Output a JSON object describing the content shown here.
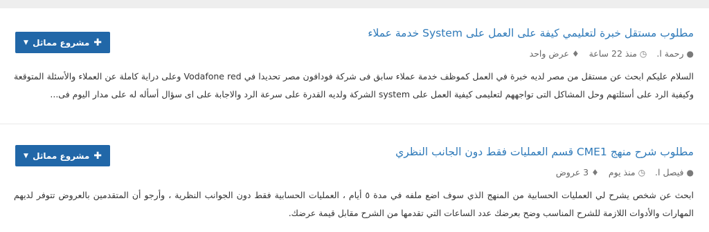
{
  "projects": [
    {
      "title": "مطلوب مستقل خبرة لتعليمي كيفة على العمل على System خدمة عملاء",
      "author": "رحمة ا.",
      "time": "منذ 22 ساعة",
      "bids": "عرض واحد",
      "desc": "السلام عليكم ابحث عن مستقل من مصر لديه خبرة في العمل كموظف خدمة عملاء سابق فى شركة فودافون مصر تحديدا في Vodafone red وعلى دراية كاملة عن العملاء والأسئلة المتوقعة وكيفية الرد على أسئلتهم وحل المشاكل التى تواجههم لتعليمى كيفية العمل على system الشركة ولديه القدرة على سرعة الرد والاجابة على اى سؤال أسأله له على مدار اليوم فى...",
      "button_label": "مشروع مماثل"
    },
    {
      "title": "مطلوب شرح منهج CME1 قسم العمليات فقط دون الجانب النظري",
      "author": "فيصل ا.",
      "time": "منذ يوم",
      "bids": "3 عروض",
      "desc": "ابحث عن شخص يشرح لي العمليات الحسابية من المنهج الذي سوف اضع ملفه في مدة ٥ أيام ، العمليات الحسابية فقط دون الجوانب النظرية ، وأرجو أن المتقدمين بالعروض تتوفر لديهم المهارات والأدوات اللازمة للشرح المناسب وضح بعرضك عدد الساعات التي تقدمها من الشرح مقابل قيمة عرضك.",
      "button_label": "مشروع مماثل"
    }
  ],
  "icons": {
    "user": "user-icon",
    "clock": "clock-icon",
    "tag": "tag-icon",
    "plus": "plus-icon",
    "caret": "caret-down-icon"
  },
  "colors": {
    "title_link": "#2f7ab9",
    "button_bg": "#2167a8",
    "meta_text": "#666666",
    "body_text": "#333333"
  }
}
